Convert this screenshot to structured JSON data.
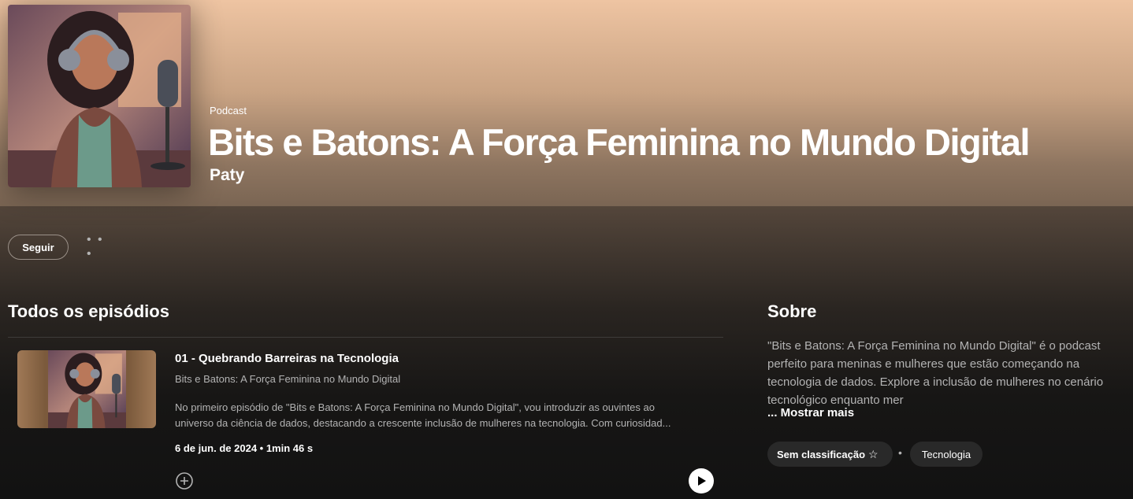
{
  "header": {
    "kind": "Podcast",
    "title": "Bits e Batons: A Força Feminina no Mundo Digital",
    "author": "Paty"
  },
  "actions": {
    "follow_label": "Seguir",
    "more_label": "• • •"
  },
  "episodes": {
    "section_title": "Todos os episódios",
    "items": [
      {
        "title": "01 - Quebrando Barreiras na Tecnologia",
        "show": "Bits e Batons: A Força Feminina no Mundo Digital",
        "description_line1": "No primeiro episódio de \"Bits e Batons: A Força Feminina no Mundo Digital\", vou introduzir as ouvintes ao",
        "description_line2": "universo da ciência de dados, destacando a crescente inclusão de mulheres na tecnologia. Com curiosidad...",
        "meta": "6 de jun. de 2024 • 1min 46 s"
      }
    ]
  },
  "about": {
    "section_title": "Sobre",
    "text": "\"Bits e Batons: A Força Feminina no Mundo Digital\" é o podcast perfeito para meninas e mulheres que estão começando na tecnologia de dados. Explore a inclusão de mulheres no cenário tecnológico enquanto mer",
    "show_more": "... Mostrar mais",
    "rating_label": "Sem classificação",
    "separator": "•",
    "category": "Tecnologia"
  },
  "icons": {
    "more": "more-horizontal-icon",
    "star": "star-outline-icon",
    "add": "add-circle-icon",
    "play": "play-icon"
  },
  "colors": {
    "header_top": "#eec4a2",
    "background": "#121212",
    "chip": "#292929",
    "secondary_text": "#b3b3b3"
  }
}
